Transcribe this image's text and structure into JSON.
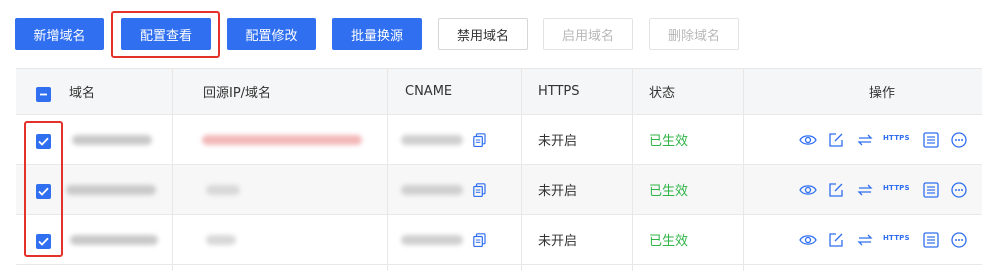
{
  "toolbar": {
    "add_domain": "新增域名",
    "view_config": "配置查看",
    "edit_config": "配置修改",
    "batch_replace": "批量换源",
    "disable_domain": "禁用域名",
    "enable_domain": "启用域名",
    "delete_domain": "删除域名"
  },
  "table": {
    "columns": [
      "域名",
      "回源IP/域名",
      "CNAME",
      "HTTPS",
      "状态",
      "操作"
    ],
    "rows": [
      {
        "https": "未开启",
        "status": "已生效",
        "checked": true
      },
      {
        "https": "未开启",
        "status": "已生效",
        "checked": true
      },
      {
        "https": "未开启",
        "status": "已生效",
        "checked": true
      }
    ]
  },
  "icons": {
    "action_https_label": "HTTPS"
  },
  "colors": {
    "primary": "#2f6ff0",
    "status_active": "#2fb446",
    "highlight": "#e4322b"
  }
}
